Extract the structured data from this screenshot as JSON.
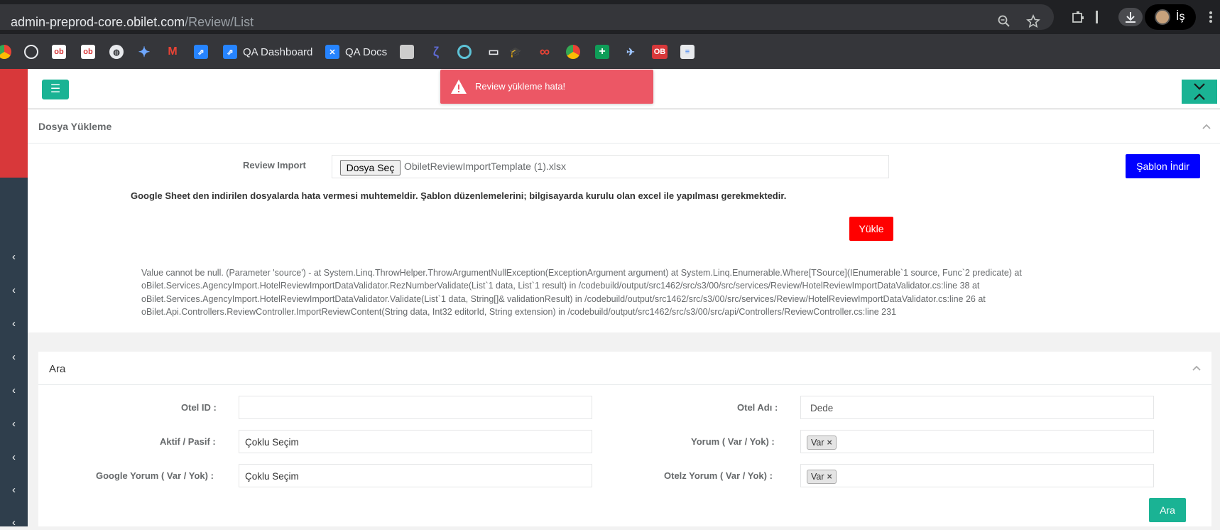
{
  "browser": {
    "url_host": "admin-preprod-core.obilet.com",
    "url_path": "/Review/List",
    "profile_label": "İş",
    "icons": [
      "zoom-icon",
      "star-icon",
      "extensions-icon",
      "download-icon",
      "menu-icon"
    ]
  },
  "bookmarks": [
    {
      "icon": "chrome-color-icon",
      "label": ""
    },
    {
      "icon": "github-icon",
      "label": ""
    },
    {
      "icon": "ob-icon",
      "label": ""
    },
    {
      "icon": "ob-icon",
      "label": ""
    },
    {
      "icon": "globe-icon",
      "label": ""
    },
    {
      "icon": "gemini-icon",
      "label": ""
    },
    {
      "icon": "gmail-icon",
      "label": ""
    },
    {
      "icon": "jira-icon",
      "label": ""
    },
    {
      "icon": "jira-icon",
      "label": "QA Dashboard"
    },
    {
      "icon": "confluence-icon",
      "label": "QA Docs"
    },
    {
      "icon": "blank-icon",
      "label": ""
    },
    {
      "icon": "linear-icon",
      "label": ""
    },
    {
      "icon": "ring-icon",
      "label": ""
    },
    {
      "icon": "folder-icon",
      "label": ""
    },
    {
      "icon": "grad-cap-icon",
      "label": ""
    },
    {
      "icon": "infinity-icon",
      "label": ""
    },
    {
      "icon": "chrome-color-icon",
      "label": ""
    },
    {
      "icon": "plus-green-icon",
      "label": ""
    },
    {
      "icon": "plane-icon",
      "label": ""
    },
    {
      "icon": "ob-red-icon",
      "label": "OB"
    },
    {
      "icon": "doc-icon",
      "label": ""
    }
  ],
  "toast": {
    "message": "Review yükleme hata!",
    "color": "#ec5765"
  },
  "upload_panel": {
    "title": "Dosya Yükleme",
    "review_import_label": "Review Import",
    "choose_file_label": "Dosya Seç",
    "file_name": "ObiletReviewImportTemplate (1).xlsx",
    "template_button": "Şablon İndir",
    "warning": "Google Sheet den indirilen dosyalarda hata vermesi muhtemeldir. Şablon düzenlemelerini; bilgisayarda kurulu olan excel ile yapılması gerekmektedir.",
    "upload_button": "Yükle",
    "error_lines": [
      "Value cannot be null. (Parameter 'source') - at System.Linq.ThrowHelper.ThrowArgumentNullException(ExceptionArgument argument) at System.Linq.Enumerable.Where[TSource](IEnumerable`1 source, Func`2 predicate) at",
      "oBilet.Services.AgencyImport.HotelReviewImportDataValidator.RezNumberValidate(List`1 data, List`1 result) in /codebuild/output/src1462/src/s3/00/src/services/Review/HotelReviewImportDataValidator.cs:line 38 at",
      "oBilet.Services.AgencyImport.HotelReviewImportDataValidator.Validate(List`1 data, String[]& validationResult) in /codebuild/output/src1462/src/s3/00/src/services/Review/HotelReviewImportDataValidator.cs:line 26 at",
      "oBilet.Api.Controllers.ReviewController.ImportReviewContent(String data, Int32 editorId, String extension) in /codebuild/output/src1462/src/s3/00/src/api/Controllers/ReviewController.cs:line 231"
    ]
  },
  "search_panel": {
    "title": "Ara",
    "fields": {
      "otel_id_label": "Otel ID :",
      "otel_id_value": "",
      "otel_adi_label": "Otel Adı :",
      "otel_adi_placeholder": "Dede",
      "aktif_label": "Aktif / Pasif :",
      "aktif_value": "Çoklu Seçim",
      "yorum_label": "Yorum ( Var / Yok) :",
      "yorum_tag": "Var",
      "google_label": "Google Yorum ( Var / Yok) :",
      "google_value": "Çoklu Seçim",
      "otelz_label": "Otelz Yorum ( Var / Yok) :",
      "otelz_tag": "Var"
    },
    "search_button": "Ara"
  },
  "colors": {
    "accent_green": "#1ab394",
    "sidebar": "#2f3e4c",
    "sidebar_top": "#d8383a",
    "template_button": "#0000ff",
    "upload_button": "#ff0000"
  }
}
